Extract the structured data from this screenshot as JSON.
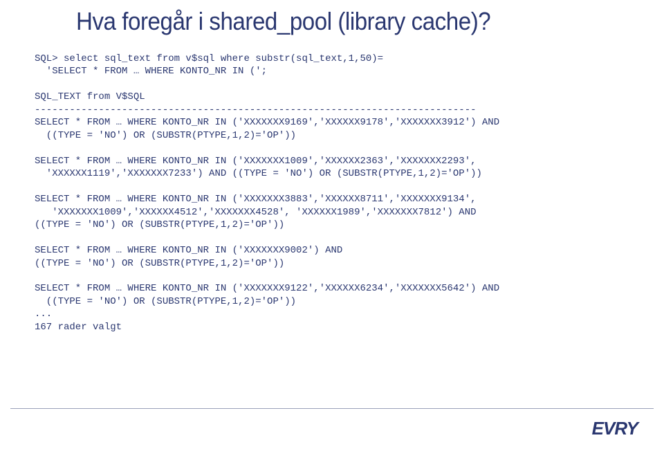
{
  "title": "Hva foregår i shared_pool (library cache)?",
  "code": "SQL> select sql_text from v$sql where substr(sql_text,1,50)=\n  'SELECT * FROM … WHERE KONTO_NR IN (';\n\nSQL_TEXT from V$SQL\n----------------------------------------------------------------------------\nSELECT * FROM … WHERE KONTO_NR IN ('XXXXXXX9169','XXXXXX9178','XXXXXXX3912') AND\n  ((TYPE = 'NO') OR (SUBSTR(PTYPE,1,2)='OP'))\n\nSELECT * FROM … WHERE KONTO_NR IN ('XXXXXXX1009','XXXXXX2363','XXXXXXX2293',\n  'XXXXXX1119','XXXXXXX7233') AND ((TYPE = 'NO') OR (SUBSTR(PTYPE,1,2)='OP'))\n\nSELECT * FROM … WHERE KONTO_NR IN ('XXXXXXX3883','XXXXXX8711','XXXXXXX9134',\n   'XXXXXXX1009','XXXXXX4512','XXXXXXX4528', 'XXXXXX1989','XXXXXXX7812') AND\n((TYPE = 'NO') OR (SUBSTR(PTYPE,1,2)='OP'))\n\nSELECT * FROM … WHERE KONTO_NR IN ('XXXXXXX9002') AND\n((TYPE = 'NO') OR (SUBSTR(PTYPE,1,2)='OP'))\n\nSELECT * FROM … WHERE KONTO_NR IN ('XXXXXXX9122','XXXXXX6234','XXXXXXX5642') AND\n  ((TYPE = 'NO') OR (SUBSTR(PTYPE,1,2)='OP'))\n...\n167 rader valgt",
  "logo_text": "EVRY"
}
